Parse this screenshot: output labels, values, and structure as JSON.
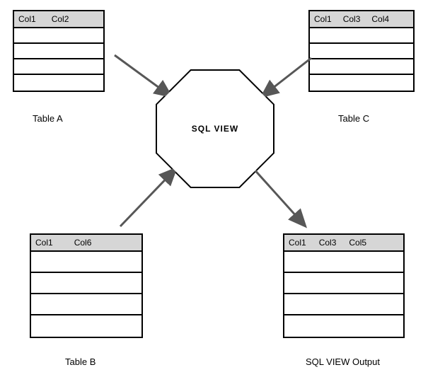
{
  "center": {
    "label": "SQL VIEW"
  },
  "tables": {
    "a": {
      "caption": "Table A",
      "columns": [
        "Col1",
        "Col2"
      ],
      "rows": 4
    },
    "b": {
      "caption": "Table B",
      "columns": [
        "Col1",
        "Col6"
      ],
      "rows": 4
    },
    "c": {
      "caption": "Table C",
      "columns": [
        "Col1",
        "Col3",
        "Col4"
      ],
      "rows": 4
    },
    "output": {
      "caption": "SQL VIEW Output",
      "columns": [
        "Col1",
        "Col3",
        "Col5"
      ],
      "rows": 4
    }
  },
  "arrows": [
    {
      "from": "a",
      "to": "center",
      "direction": "in"
    },
    {
      "from": "c",
      "to": "center",
      "direction": "in"
    },
    {
      "from": "b",
      "to": "center",
      "direction": "in"
    },
    {
      "from": "center",
      "to": "output",
      "direction": "out"
    }
  ],
  "colors": {
    "tableHeaderFill": "#d6d6d6",
    "stroke": "#000000",
    "arrow": "#575757"
  }
}
